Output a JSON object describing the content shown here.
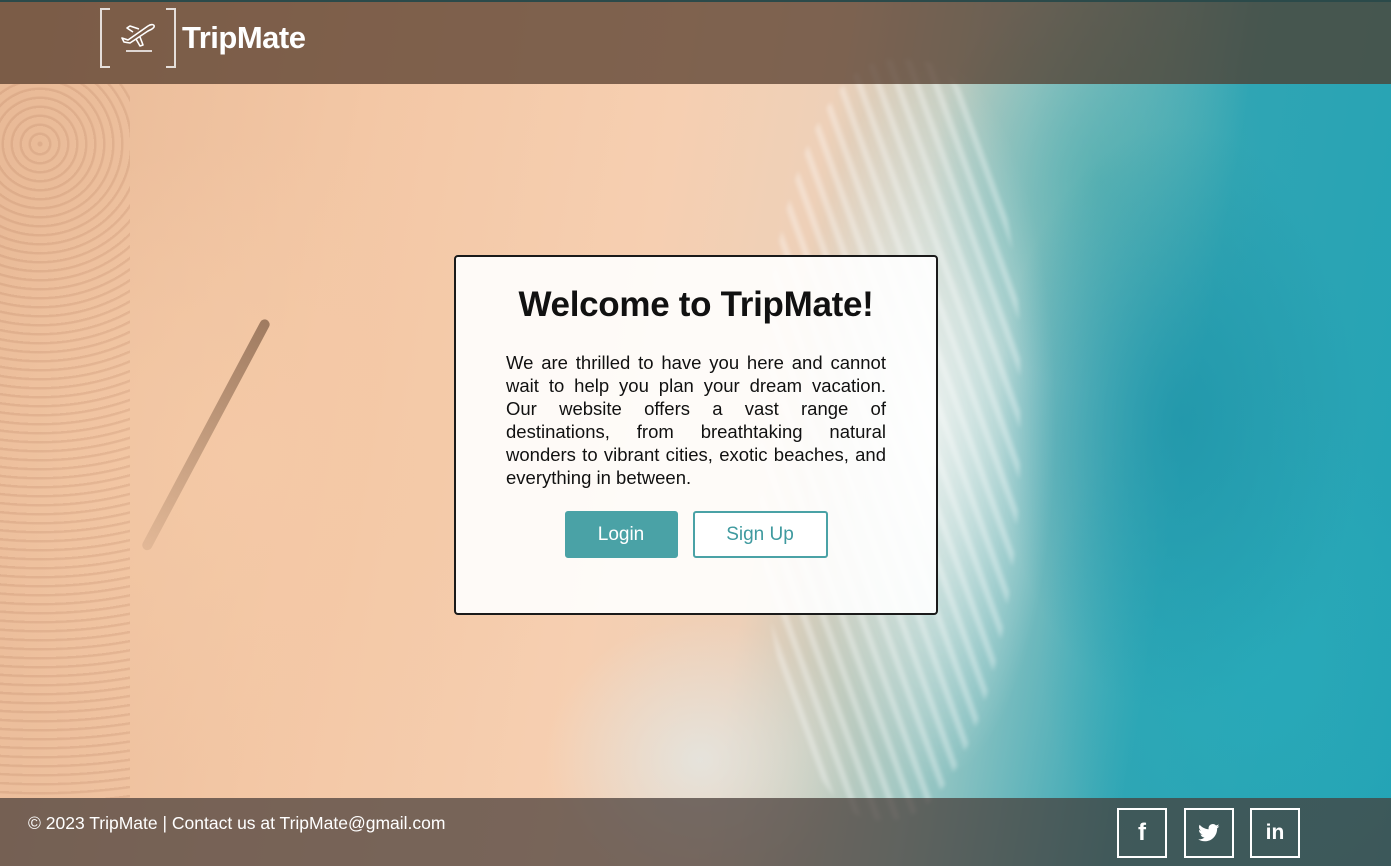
{
  "header": {
    "brand_name": "TripMate",
    "logo_icon": "airplane-icon"
  },
  "welcome": {
    "title": "Welcome to TripMate!",
    "message": "We are thrilled to have you here and cannot wait to help you plan your dream vacation. Our website offers a vast range of destinations, from breathtaking natural wonders to vibrant cities, exotic beaches, and everything in between.",
    "login_label": "Login",
    "signup_label": "Sign Up"
  },
  "footer": {
    "copyright": "© 2023 TripMate | Contact us at TripMate@gmail.com",
    "social": [
      {
        "name": "facebook-icon",
        "glyph": "f"
      },
      {
        "name": "twitter-icon"
      },
      {
        "name": "linkedin-icon",
        "glyph": "in"
      }
    ]
  },
  "colors": {
    "accent": "#4aa2a6",
    "header_bg": "#50372899",
    "text": "#111111"
  }
}
